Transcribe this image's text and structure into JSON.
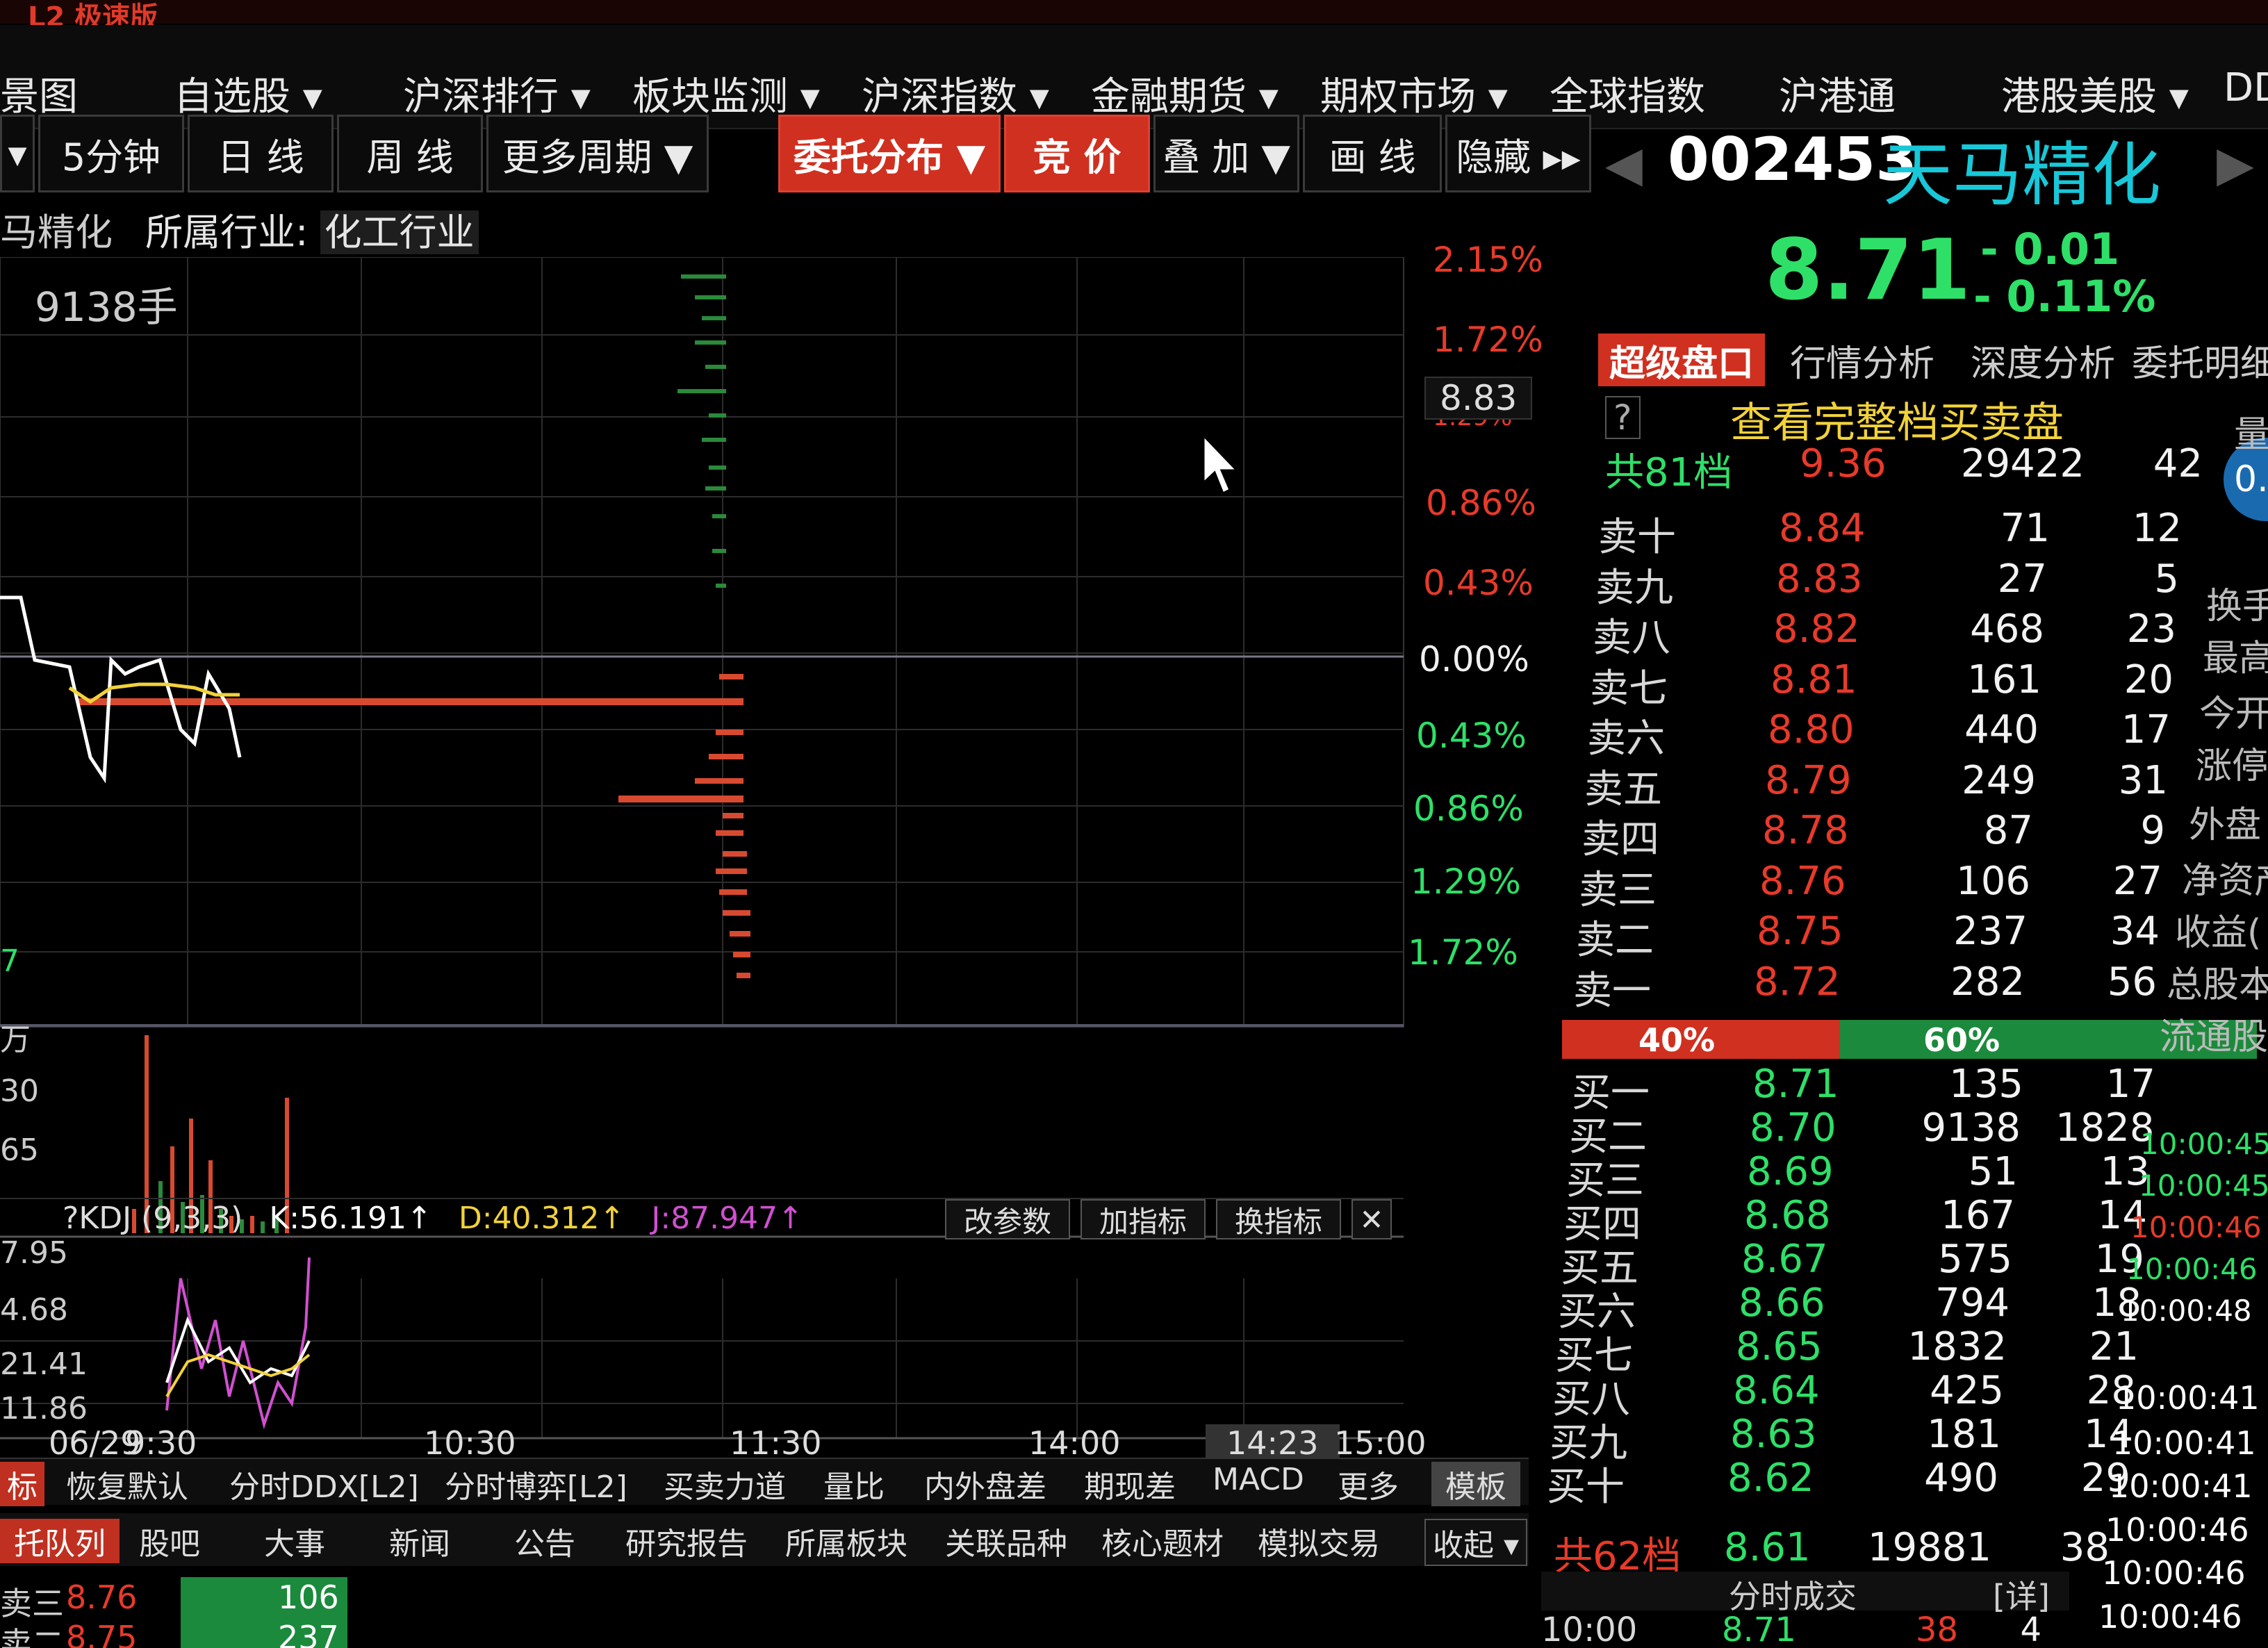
{
  "top_partial_title": "L2 极速版",
  "menu": {
    "items": [
      "景图",
      "自选股 ▾",
      "沪深排行 ▾",
      "板块监测 ▾",
      "沪深指数 ▾",
      "金融期货 ▾",
      "期权市场 ▾",
      "全球指数",
      "沪港通",
      "港股美股 ▾",
      "DDE"
    ]
  },
  "toolbar": {
    "buttons": [
      "▾",
      "5分钟",
      "日 线",
      "周 线",
      "更多周期 ▼",
      "委托分布 ▼",
      "竞 价",
      "叠 加 ▼",
      "画 线",
      "隐藏 ▸▸"
    ]
  },
  "industry": {
    "name_partial": "马精化",
    "label": "所属行业:",
    "value": "化工行业"
  },
  "chart": {
    "volume_label": "9138手",
    "pct_up": [
      "2.15%",
      "1.72%",
      "1.29%",
      "0.86%",
      "0.43%"
    ],
    "pct_zero": "0.00%",
    "pct_down": [
      "0.43%",
      "0.86%",
      "1.29%",
      "1.72%"
    ],
    "price_marker": "8.83",
    "left_cut_labels": [
      "7",
      "万",
      "30",
      "65",
      "7.95",
      "4.68",
      "21.41",
      "11.86"
    ],
    "kdj": {
      "name": "?KDJ (9,3,3)",
      "k": "K:56.191↑",
      "d": "D:40.312↑",
      "j": "J:87.947↑"
    },
    "kdj_buttons": [
      "改参数",
      "加指标",
      "换指标",
      "✕"
    ],
    "times": [
      "06/29",
      "9:30",
      "10:30",
      "11:30",
      "14:00",
      "14:23",
      "15:00"
    ]
  },
  "bottom_tabs": [
    "标",
    "恢复默认",
    "分时DDX[L2]",
    "分时博弈[L2]",
    "买卖力道",
    "量比",
    "内外盘差",
    "期现差",
    "MACD",
    "更多",
    "模板"
  ],
  "tabs2": [
    "托队列",
    "股吧",
    "大事",
    "新闻",
    "公告",
    "研究报告",
    "所属板块",
    "关联品种",
    "核心题材",
    "模拟交易",
    "收起 ▾"
  ],
  "queue_rows": [
    {
      "label": "卖三",
      "price": "8.76",
      "vol": "106"
    },
    {
      "label": "卖二",
      "price": "8.75",
      "vol": "237"
    }
  ],
  "stock": {
    "code": "002453",
    "name": "天马精化",
    "price": "8.71",
    "change": "- 0.01",
    "change_pct": "- 0.11%"
  },
  "right_tabs": [
    "超级盘口",
    "行情分析",
    "深度分析",
    "委托明细"
  ],
  "book_header": {
    "help": "?",
    "link": "查看完整档买卖盘"
  },
  "sell_total": {
    "label": "共81档",
    "price": "9.36",
    "vol": "29422",
    "cnt": "42"
  },
  "sells": [
    {
      "label": "卖十",
      "price": "8.84",
      "vol": "71",
      "cnt": "12"
    },
    {
      "label": "卖九",
      "price": "8.83",
      "vol": "27",
      "cnt": "5"
    },
    {
      "label": "卖八",
      "price": "8.82",
      "vol": "468",
      "cnt": "23"
    },
    {
      "label": "卖七",
      "price": "8.81",
      "vol": "161",
      "cnt": "20"
    },
    {
      "label": "卖六",
      "price": "8.80",
      "vol": "440",
      "cnt": "17"
    },
    {
      "label": "卖五",
      "price": "8.79",
      "vol": "249",
      "cnt": "31"
    },
    {
      "label": "卖四",
      "price": "8.78",
      "vol": "87",
      "cnt": "9"
    },
    {
      "label": "卖三",
      "price": "8.76",
      "vol": "106",
      "cnt": "27"
    },
    {
      "label": "卖二",
      "price": "8.75",
      "vol": "237",
      "cnt": "34"
    },
    {
      "label": "卖一",
      "price": "8.72",
      "vol": "282",
      "cnt": "56"
    }
  ],
  "ratio": {
    "sell": "40%",
    "buy": "60%",
    "sell_fraction": 0.4
  },
  "buys": [
    {
      "label": "买一",
      "price": "8.71",
      "vol": "135",
      "cnt": "17"
    },
    {
      "label": "买二",
      "price": "8.70",
      "vol": "9138",
      "cnt": "1828"
    },
    {
      "label": "买三",
      "price": "8.69",
      "vol": "51",
      "cnt": "13"
    },
    {
      "label": "买四",
      "price": "8.68",
      "vol": "167",
      "cnt": "14"
    },
    {
      "label": "买五",
      "price": "8.67",
      "vol": "575",
      "cnt": "19"
    },
    {
      "label": "买六",
      "price": "8.66",
      "vol": "794",
      "cnt": "18"
    },
    {
      "label": "买七",
      "price": "8.65",
      "vol": "1832",
      "cnt": "21"
    },
    {
      "label": "买八",
      "price": "8.64",
      "vol": "425",
      "cnt": "28"
    },
    {
      "label": "买九",
      "price": "8.63",
      "vol": "181",
      "cnt": "14"
    },
    {
      "label": "买十",
      "price": "8.62",
      "vol": "490",
      "cnt": "29"
    }
  ],
  "buy_total": {
    "label": "共62档",
    "price": "8.61",
    "vol": "19881",
    "cnt": "38"
  },
  "tick_header": {
    "title": "分时成交",
    "detail": "[详]"
  },
  "tick_first": {
    "time": "10:00",
    "price": "8.71",
    "vol": "38",
    "cnt": "4"
  },
  "right_edge_labels": [
    "量",
    "0.",
    "换手",
    "最高",
    "今开",
    "涨停",
    "外盘",
    "净资产",
    "收益(",
    "总股本",
    "流通股"
  ],
  "right_edge_times": [
    "10:00:45",
    "10:00:45",
    "10:00:46",
    "10:00:46",
    "10:00:48"
  ],
  "tick_times": [
    "10:00:41",
    "10:00:41",
    "10:00:41",
    "10:00:46",
    "10:00:46",
    "10:00:46"
  ]
}
